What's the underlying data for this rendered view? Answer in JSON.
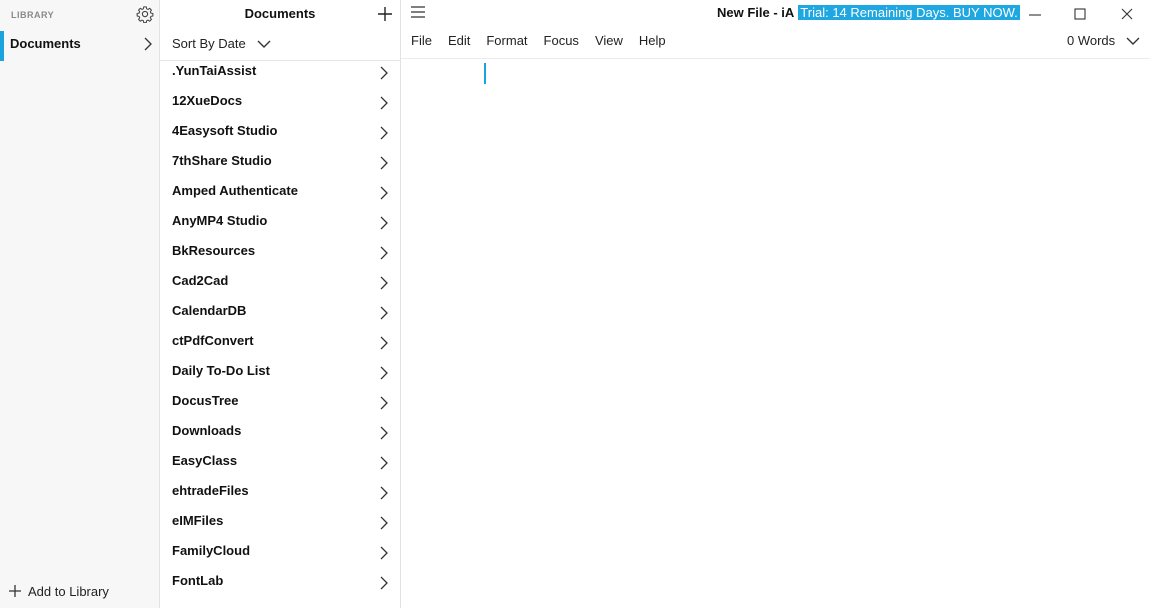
{
  "library": {
    "header": "LIBRARY",
    "items": [
      {
        "label": "Documents"
      }
    ],
    "add_label": "Add to Library"
  },
  "documents": {
    "title": "Documents",
    "sort_label": "Sort By Date",
    "folders": [
      ".YunTaiAssist",
      "12XueDocs",
      "4Easysoft Studio",
      "7thShare Studio",
      "Amped Authenticate",
      "AnyMP4 Studio",
      "BkResources",
      "Cad2Cad",
      "CalendarDB",
      "ctPdfConvert",
      "Daily To-Do List",
      "DocusTree",
      "Downloads",
      "EasyClass",
      "ehtradeFiles",
      "eIMFiles",
      "FamilyCloud",
      "FontLab"
    ]
  },
  "editor": {
    "window_title": "New File - iA",
    "trial_banner": "Trial: 14 Remaining Days. BUY NOW.",
    "menu": [
      "File",
      "Edit",
      "Format",
      "Focus",
      "View",
      "Help"
    ],
    "word_count": "0 Words"
  },
  "colors": {
    "accent": "#1aa3dc",
    "trial_bg": "#1ea7e0"
  },
  "icons": [
    "gear-icon",
    "chevron-right-icon",
    "plus-icon",
    "chevron-down-icon",
    "menu-icon",
    "minimize-icon",
    "maximize-icon",
    "close-icon"
  ]
}
